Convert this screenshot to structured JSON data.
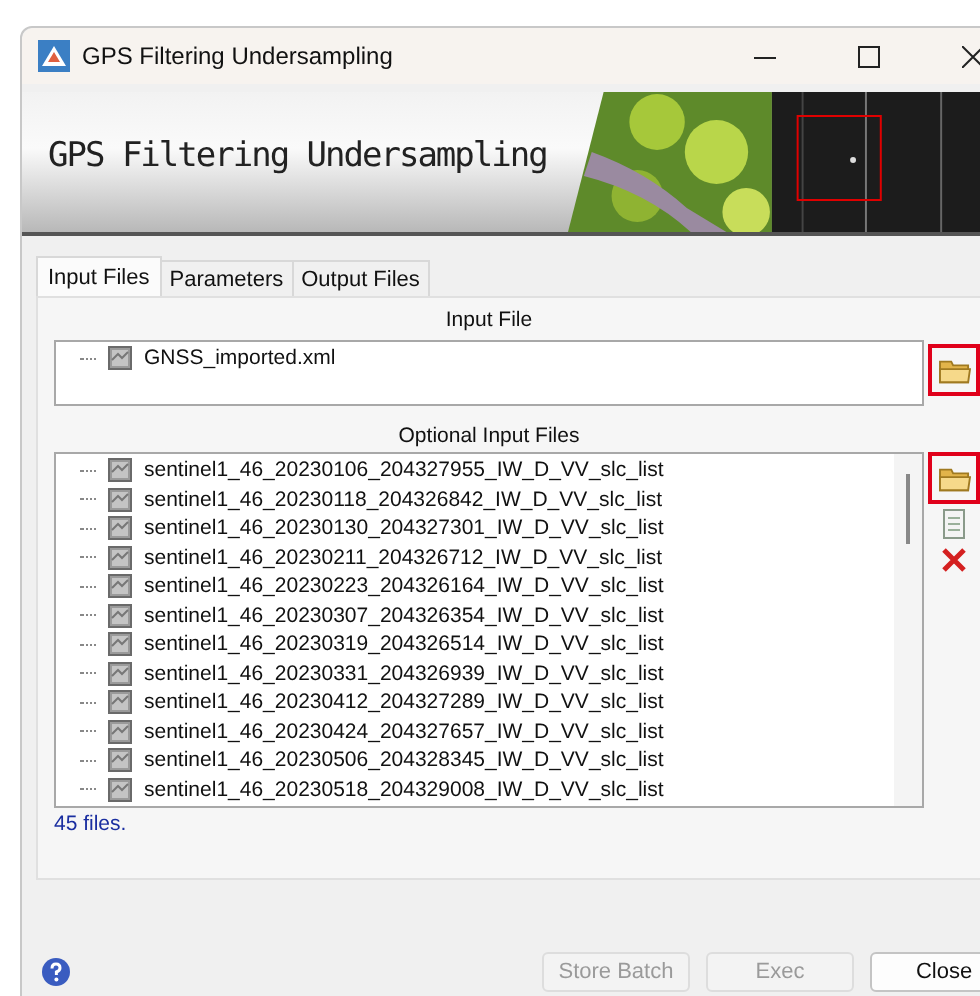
{
  "window": {
    "title": "GPS Filtering Undersampling"
  },
  "banner": {
    "title": "GPS Filtering Undersampling"
  },
  "tabs": [
    {
      "label": "Input Files",
      "selected": true
    },
    {
      "label": "Parameters",
      "selected": false
    },
    {
      "label": "Output Files",
      "selected": false
    }
  ],
  "input_file": {
    "label": "Input File",
    "items": [
      "GNSS_imported.xml"
    ],
    "browse_highlighted": true
  },
  "optional_input_files": {
    "label": "Optional Input Files",
    "browse_highlighted": true,
    "items": [
      "sentinel1_46_20230106_204327955_IW_D_VV_slc_list",
      "sentinel1_46_20230118_204326842_IW_D_VV_slc_list",
      "sentinel1_46_20230130_204327301_IW_D_VV_slc_list",
      "sentinel1_46_20230211_204326712_IW_D_VV_slc_list",
      "sentinel1_46_20230223_204326164_IW_D_VV_slc_list",
      "sentinel1_46_20230307_204326354_IW_D_VV_slc_list",
      "sentinel1_46_20230319_204326514_IW_D_VV_slc_list",
      "sentinel1_46_20230331_204326939_IW_D_VV_slc_list",
      "sentinel1_46_20230412_204327289_IW_D_VV_slc_list",
      "sentinel1_46_20230424_204327657_IW_D_VV_slc_list",
      "sentinel1_46_20230506_204328345_IW_D_VV_slc_list",
      "sentinel1_46_20230518_204329008_IW_D_VV_slc_list"
    ],
    "count": "45 files."
  },
  "buttons": [
    {
      "label": "Store Batch",
      "disabled": true
    },
    {
      "label": "Exec",
      "disabled": true
    },
    {
      "label": "Close",
      "disabled": false
    }
  ]
}
